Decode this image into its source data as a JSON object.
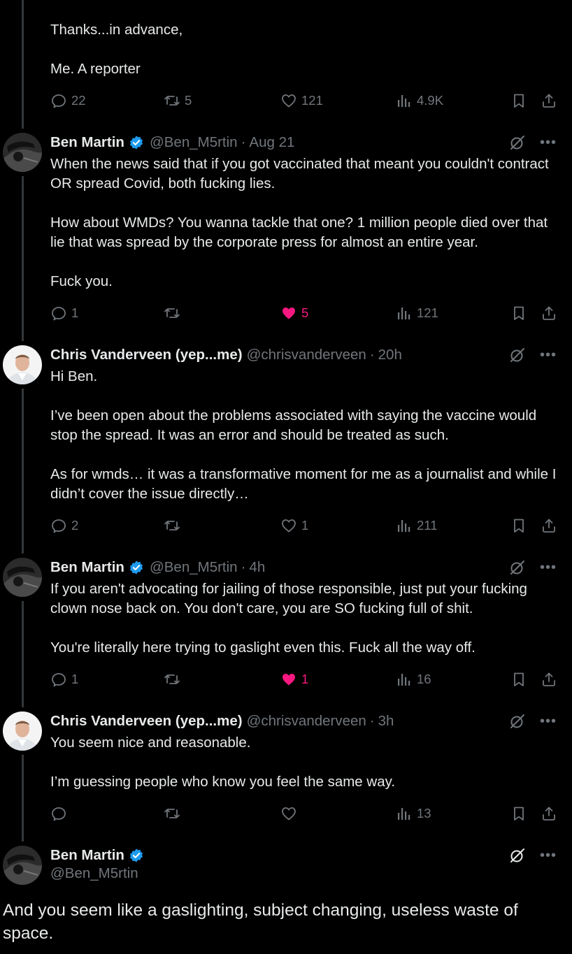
{
  "colors": {
    "background": "#000000",
    "text": "#e7e9ea",
    "muted": "#71767b",
    "verified": "#1d9bf0",
    "like": "#f91880",
    "thread_line": "#333639"
  },
  "top_reply": {
    "lines": [
      "Thanks...in advance,",
      "Me. A reporter"
    ],
    "replies": "22",
    "reposts": "5",
    "likes": "121",
    "views": "4.9K"
  },
  "reply1": {
    "name": "Ben Martin",
    "handle": "@Ben_M5rtin",
    "time": "Aug 21",
    "paragraphs": [
      "When the news said that if you got vaccinated that meant you couldn't contract OR spread Covid, both fucking lies.",
      "How about WMDs? You wanna tackle that one? 1 million people died over that lie that was spread by the corporate press for almost an entire year.",
      "Fuck you."
    ],
    "replies": "1",
    "reposts": "",
    "likes": "5",
    "views": "121"
  },
  "reply2": {
    "name": "Chris Vanderveen (yep...me)",
    "handle": "@chrisvanderveen",
    "time": "20h",
    "paragraphs": [
      "Hi Ben.",
      "I’ve been open about the problems associated with saying the vaccine would stop the spread.  It was an error and should be treated as such.",
      "As for wmds… it was a transformative moment for me as a journalist and while I didn’t cover the issue directly…"
    ],
    "replies": "2",
    "reposts": "",
    "likes": "1",
    "views": "211"
  },
  "reply3": {
    "name": "Ben Martin",
    "handle": "@Ben_M5rtin",
    "time": "4h",
    "paragraphs": [
      "If you aren't advocating for jailing of those responsible, just put your fucking clown nose back on. You don't care, you are SO fucking full of shit.",
      "You're literally here trying to gaslight even this. Fuck all the way off."
    ],
    "replies": "1",
    "reposts": "",
    "likes": "1",
    "views": "16"
  },
  "reply4": {
    "name": "Chris Vanderveen (yep...me)",
    "handle": "@chrisvanderveen",
    "time": "3h",
    "paragraphs": [
      "You seem nice and reasonable.",
      "I’m guessing people who know you feel the same way."
    ],
    "replies": "",
    "reposts": "",
    "likes": "",
    "views": "13"
  },
  "main_post": {
    "name": "Ben Martin",
    "handle": "@Ben_M5rtin",
    "text": "And you seem like a gaslighting, subject changing, useless waste of space."
  },
  "time_separator": "·",
  "more_label": "•••",
  "icons": {
    "reply": "reply-icon",
    "repost": "repost-icon",
    "like": "heart-icon",
    "views": "views-icon",
    "bookmark": "bookmark-icon",
    "share": "share-icon",
    "grok": "grok-icon",
    "verified": "verified-badge-icon"
  }
}
